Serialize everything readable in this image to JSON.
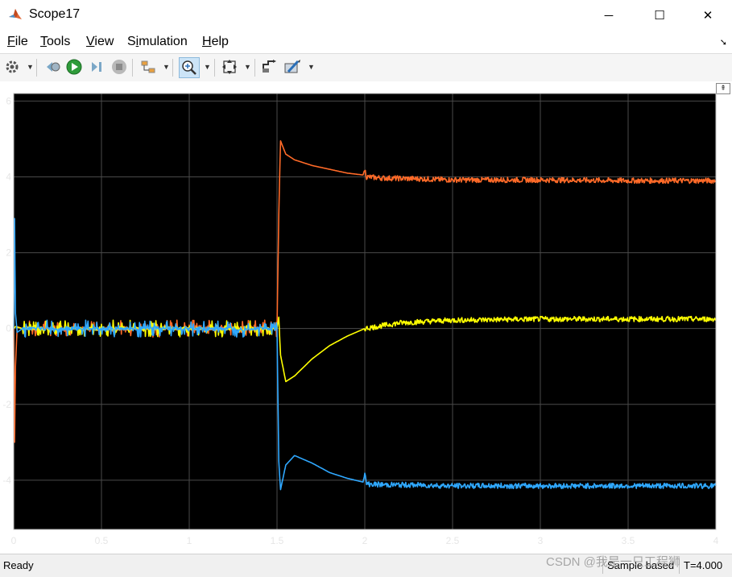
{
  "window": {
    "title": "Scope17",
    "minimize_glyph": "─",
    "maximize_glyph": "☐",
    "close_glyph": "✕"
  },
  "menu": [
    {
      "key": "F",
      "rest": "ile"
    },
    {
      "key": "T",
      "rest": "ools"
    },
    {
      "key": "V",
      "rest": "iew"
    },
    {
      "pre": "S",
      "key": "i",
      "rest": "mulation"
    },
    {
      "key": "H",
      "rest": "elp"
    }
  ],
  "toolbar": {
    "icons": [
      "gear-icon",
      "step-back-icon",
      "run-icon",
      "step-forward-icon",
      "stop-icon",
      "signal-select-icon",
      "zoom-icon",
      "fit-view-icon",
      "cursor-measure-icon",
      "style-icon"
    ]
  },
  "status": {
    "left": "Ready",
    "mode": "Sample based",
    "time": "T=4.000"
  },
  "watermark": "CSDN @我是一只工程狮",
  "colors": {
    "plot_bg": "#000000",
    "grid": "#4a4a4a",
    "axis_text": "#e6e6e6",
    "series1": "#0072BD",
    "series2": "#D95319",
    "series3": "#EDB120"
  },
  "chart_data": {
    "type": "line",
    "title": "",
    "xlabel": "",
    "ylabel": "",
    "xlim": [
      0,
      4
    ],
    "ylim": [
      -5.3,
      6.2
    ],
    "xticks": [
      "0",
      "0.5",
      "1",
      "1.5",
      "2",
      "2.5",
      "3",
      "3.5",
      "4"
    ],
    "yticks": [
      "6",
      "4",
      "2",
      "0",
      "-2",
      "-4"
    ],
    "grid": true,
    "series": [
      {
        "color": "#FF6A28",
        "x": [
          0,
          0.005,
          0.01,
          0.02,
          0.05,
          1.5,
          1.51,
          1.52,
          1.55,
          1.6,
          1.7,
          1.8,
          1.9,
          1.99,
          2.0,
          2.01,
          2.1,
          2.3,
          2.5,
          3.0,
          3.5,
          4.0
        ],
        "y": [
          0,
          -3.0,
          -1.0,
          0.05,
          0,
          0,
          3.0,
          4.95,
          4.6,
          4.45,
          4.3,
          4.2,
          4.1,
          4.05,
          4.2,
          4.0,
          3.97,
          3.95,
          3.92,
          3.92,
          3.9,
          3.9
        ]
      },
      {
        "color": "#FFFF00",
        "x": [
          0,
          0.01,
          0.05,
          1.5,
          1.51,
          1.52,
          1.55,
          1.6,
          1.7,
          1.8,
          1.9,
          2.0,
          2.2,
          2.5,
          3.0,
          3.5,
          4.0
        ],
        "y": [
          0,
          0.05,
          0,
          0,
          0.3,
          -0.7,
          -1.4,
          -1.25,
          -0.8,
          -0.45,
          -0.2,
          0,
          0.15,
          0.22,
          0.25,
          0.25,
          0.25
        ]
      },
      {
        "color": "#2FA8FF",
        "x": [
          0,
          0.005,
          0.01,
          0.02,
          0.05,
          1.5,
          1.51,
          1.52,
          1.55,
          1.6,
          1.7,
          1.8,
          1.9,
          1.99,
          2.0,
          2.01,
          2.1,
          2.3,
          2.5,
          3.0,
          3.5,
          4.0
        ],
        "y": [
          0,
          2.9,
          0.4,
          -0.1,
          0,
          0,
          -3.5,
          -4.25,
          -3.6,
          -3.35,
          -3.55,
          -3.8,
          -3.95,
          -4.05,
          -3.85,
          -4.1,
          -4.12,
          -4.13,
          -4.15,
          -4.15,
          -4.15,
          -4.15
        ]
      }
    ]
  }
}
